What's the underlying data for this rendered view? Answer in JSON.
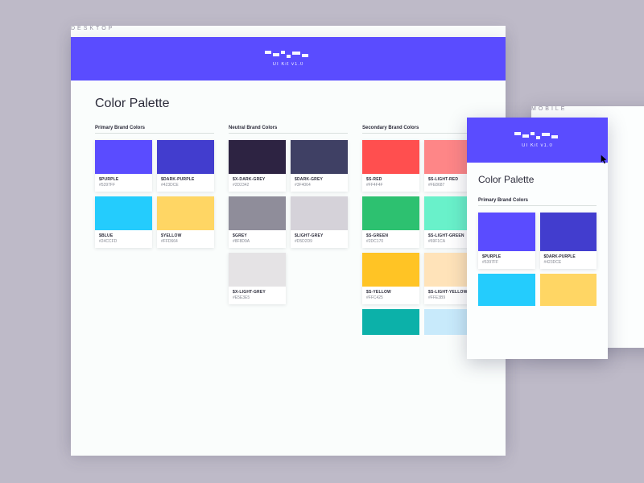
{
  "labels": {
    "desktop": "DESKTOP",
    "mobile": "MOBILE"
  },
  "header": {
    "kit": "UI Kit v1.0"
  },
  "desktop": {
    "title": "Color Palette",
    "groups": {
      "primary": {
        "heading": "Primary Brand Colors",
        "items": [
          {
            "name": "$PURPLE",
            "hex": "#5397FF",
            "color": "#5a4cff"
          },
          {
            "name": "$DARK-PURPLE",
            "hex": "#423DCE",
            "color": "#423dce"
          },
          {
            "name": "$BLUE",
            "hex": "#24CCFD",
            "color": "#24ccfd"
          },
          {
            "name": "$YELLOW",
            "hex": "#FFD664",
            "color": "#ffd664"
          }
        ]
      },
      "neutral": {
        "heading": "Neutral Brand Colors",
        "items": [
          {
            "name": "$X-DARK-GREY",
            "hex": "#2D2342",
            "color": "#2d2342"
          },
          {
            "name": "$DARK-GREY",
            "hex": "#3F4064",
            "color": "#3f4064"
          },
          {
            "name": "$GREY",
            "hex": "#8F8D9A",
            "color": "#8f8d9a"
          },
          {
            "name": "$LIGHT-GREY",
            "hex": "#D5D2D9",
            "color": "#d5d2d9"
          }
        ],
        "tail": {
          "name": "$X-LIGHT-GREY",
          "hex": "#E5E3E5",
          "color": "#e5e3e5"
        }
      },
      "secondary": {
        "heading": "Secondary Brand Colors",
        "items": [
          {
            "name": "$S-RED",
            "hex": "#FF4F4F",
            "color": "#ff4f4f"
          },
          {
            "name": "$S-LIGHT-RED",
            "hex": "#FE8687",
            "color": "#fe8687"
          },
          {
            "name": "$S-GREEN",
            "hex": "#2DC170",
            "color": "#2dc170"
          },
          {
            "name": "$S-LIGHT-GREEN",
            "hex": "#69F1CA",
            "color": "#69f1ca"
          },
          {
            "name": "$S-YELLOW",
            "hex": "#FFC425",
            "color": "#ffc425"
          },
          {
            "name": "$S-LIGHT-YELLOW",
            "hex": "#FFE3B9",
            "color": "#ffe3b9"
          }
        ],
        "extras": [
          {
            "color": "#0cb1a9"
          },
          {
            "color": "#c8eafb"
          }
        ]
      }
    }
  },
  "mobile": {
    "title": "Color Palette",
    "heading": "Primary Brand Colors",
    "items": [
      {
        "name": "$PURPLE",
        "hex": "#5397FF",
        "color": "#5a4cff"
      },
      {
        "name": "$DARK-PURPLE",
        "hex": "#423DCE",
        "color": "#423dce"
      }
    ],
    "row2": [
      {
        "color": "#24ccfd"
      },
      {
        "color": "#ffd664"
      }
    ]
  }
}
